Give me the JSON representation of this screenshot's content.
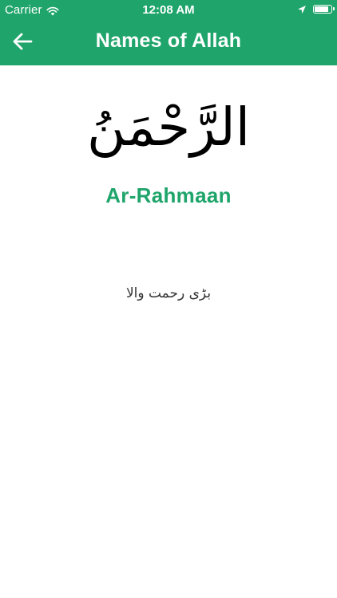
{
  "status_bar": {
    "carrier": "Carrier",
    "time": "12:08 AM",
    "battery_level": 0.95,
    "icons": [
      "wifi-icon",
      "location-icon",
      "battery-icon"
    ]
  },
  "header": {
    "title": "Names of Allah",
    "back_icon": "arrow-left-icon",
    "background_color": "#1fa56b",
    "text_color": "#ffffff"
  },
  "name": {
    "arabic": "الرَّحْمَنُ",
    "transliteration": "Ar-Rahmaan",
    "accent_color": "#1fa56b",
    "urdu_meaning": "بڑی رحمت والا"
  }
}
